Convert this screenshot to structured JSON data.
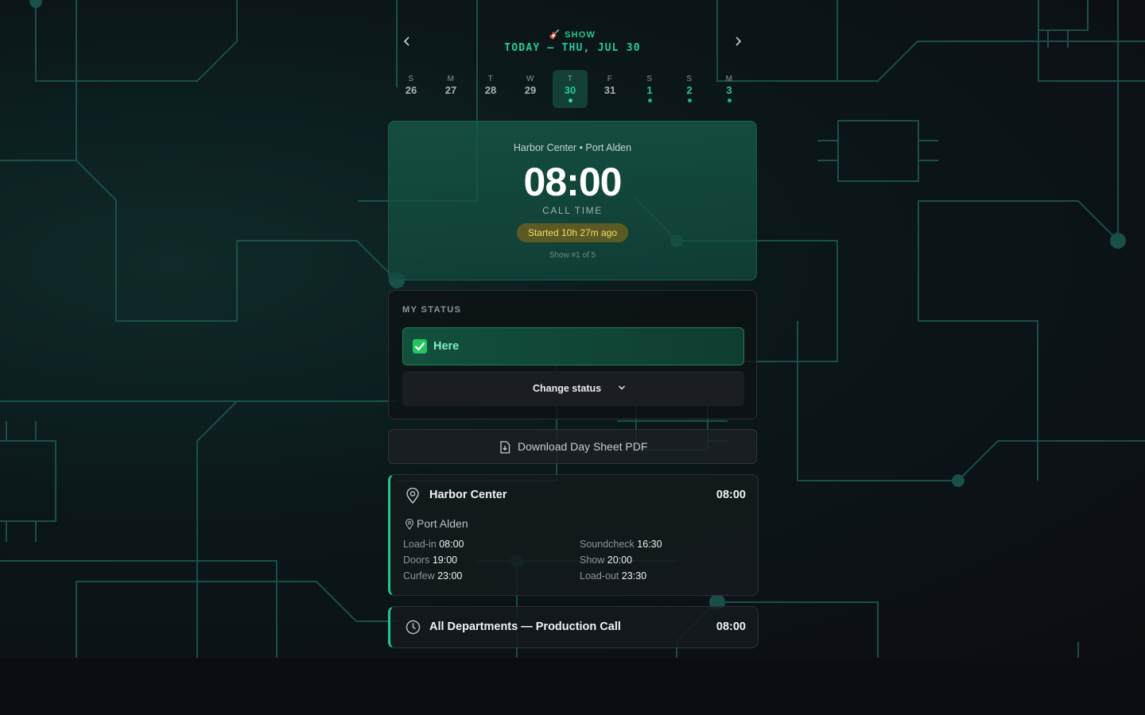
{
  "header": {
    "kind_icon": "guitar-icon",
    "kind_label": "SHOW",
    "title": "TODAY — THU, JUL 30"
  },
  "week": [
    {
      "dow": "S",
      "day": "26",
      "active": false,
      "has_show": false
    },
    {
      "dow": "M",
      "day": "27",
      "active": false,
      "has_show": false
    },
    {
      "dow": "T",
      "day": "28",
      "active": false,
      "has_show": false
    },
    {
      "dow": "W",
      "day": "29",
      "active": false,
      "has_show": false
    },
    {
      "dow": "T",
      "day": "30",
      "active": true,
      "has_show": true
    },
    {
      "dow": "F",
      "day": "31",
      "active": false,
      "has_show": false
    },
    {
      "dow": "S",
      "day": "1",
      "active": false,
      "has_show": true
    },
    {
      "dow": "S",
      "day": "2",
      "active": false,
      "has_show": true
    },
    {
      "dow": "M",
      "day": "3",
      "active": false,
      "has_show": true
    }
  ],
  "hero": {
    "venue_line": "Harbor Center • Port Alden",
    "time": "08:00",
    "label": "CALL TIME",
    "elapsed": "Started 10h 27m ago",
    "show_index": "Show #1 of 5"
  },
  "status": {
    "label": "MY STATUS",
    "current": "Here",
    "current_icon": "check-box-icon",
    "change_label": "Change status"
  },
  "download": {
    "label": "Download Day Sheet PDF",
    "icon": "file-download-icon"
  },
  "venue": {
    "name": "Harbor Center",
    "time": "08:00",
    "city": "Port Alden",
    "schedule": {
      "load_in": {
        "label": "Load-in",
        "value": "08:00"
      },
      "soundcheck": {
        "label": "Soundcheck",
        "value": "16:30"
      },
      "doors": {
        "label": "Doors",
        "value": "19:00"
      },
      "show": {
        "label": "Show",
        "value": "20:00"
      },
      "curfew": {
        "label": "Curfew",
        "value": "23:00"
      },
      "load_out": {
        "label": "Load-out",
        "value": "23:30"
      }
    }
  },
  "event": {
    "name": "All Departments — Production Call",
    "time": "08:00",
    "icon": "clock-icon"
  },
  "colors": {
    "accent": "#22c98a",
    "background": "#0c0d12",
    "pill_bg": "#5b5a24",
    "pill_text": "#f2df6a"
  }
}
